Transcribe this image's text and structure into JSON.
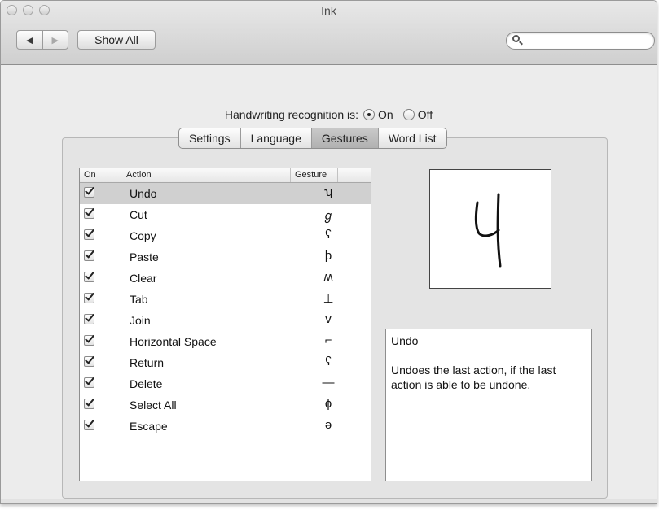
{
  "window": {
    "title": "Ink"
  },
  "toolbar": {
    "back_glyph": "◀",
    "forward_glyph": "▶",
    "show_all_label": "Show All",
    "search_placeholder": "",
    "search_icon": "magnifier-icon"
  },
  "recognition": {
    "label": "Handwriting recognition is:",
    "options": [
      {
        "label": "On",
        "selected": true
      },
      {
        "label": "Off",
        "selected": false
      }
    ]
  },
  "tabs": [
    {
      "label": "Settings",
      "selected": false
    },
    {
      "label": "Language",
      "selected": false
    },
    {
      "label": "Gestures",
      "selected": true
    },
    {
      "label": "Word List",
      "selected": false
    }
  ],
  "gesture_list": {
    "headers": {
      "on": "On",
      "action": "Action",
      "gesture": "Gesture"
    },
    "rows": [
      {
        "action": "Undo",
        "gesture": "ʮ",
        "checked": true,
        "selected": true
      },
      {
        "action": "Cut",
        "gesture": "ℊ",
        "checked": true,
        "selected": false
      },
      {
        "action": "Copy",
        "gesture": "ʢ",
        "checked": true,
        "selected": false
      },
      {
        "action": "Paste",
        "gesture": "þ",
        "checked": true,
        "selected": false
      },
      {
        "action": "Clear",
        "gesture": "ʍ",
        "checked": true,
        "selected": false
      },
      {
        "action": "Tab",
        "gesture": "⊥",
        "checked": true,
        "selected": false
      },
      {
        "action": "Join",
        "gesture": "v",
        "checked": true,
        "selected": false
      },
      {
        "action": "Horizontal Space",
        "gesture": "⌐",
        "checked": true,
        "selected": false
      },
      {
        "action": "Return",
        "gesture": "ʕ",
        "checked": true,
        "selected": false
      },
      {
        "action": "Delete",
        "gesture": "—",
        "checked": true,
        "selected": false
      },
      {
        "action": "Select All",
        "gesture": "ɸ",
        "checked": true,
        "selected": false
      },
      {
        "action": "Escape",
        "gesture": "ǝ",
        "checked": true,
        "selected": false
      }
    ]
  },
  "preview": {
    "icon": "undo-gesture-drawing"
  },
  "description": {
    "title": "Undo",
    "body": "Undoes the last action, if the last action is able to be undone."
  }
}
